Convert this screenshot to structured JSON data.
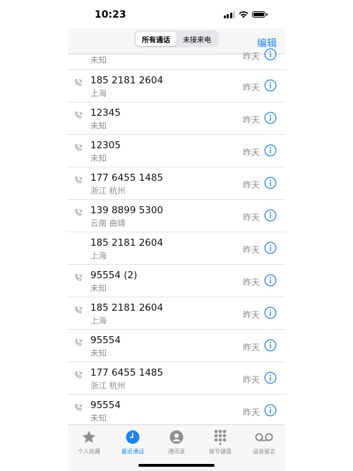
{
  "status": {
    "time": "10:23"
  },
  "header": {
    "segments": [
      "所有通话",
      "未接来电"
    ],
    "edit_label": "编辑"
  },
  "calls": [
    {
      "number": "",
      "location": "未知",
      "date": "昨天"
    },
    {
      "number": "185 2181 2604",
      "location": "上海",
      "date": "昨天",
      "icon": true
    },
    {
      "number": "12345",
      "location": "未知",
      "date": "昨天",
      "icon": true
    },
    {
      "number": "12305",
      "location": "未知",
      "date": "昨天",
      "icon": true
    },
    {
      "number": "177 6455 1485",
      "location": "浙江 杭州",
      "date": "昨天",
      "icon": true
    },
    {
      "number": "139 8899 5300",
      "location": "云南 曲靖",
      "date": "昨天",
      "icon": true
    },
    {
      "number": "185 2181 2604",
      "location": "上海",
      "date": "昨天",
      "icon": false
    },
    {
      "number": "95554 (2)",
      "location": "未知",
      "date": "昨天",
      "icon": true
    },
    {
      "number": "185 2181 2604",
      "location": "上海",
      "date": "昨天",
      "icon": true
    },
    {
      "number": "95554",
      "location": "未知",
      "date": "昨天",
      "icon": true
    },
    {
      "number": "177 6455 1485",
      "location": "浙江 杭州",
      "date": "昨天",
      "icon": true
    },
    {
      "number": "95554",
      "location": "未知",
      "date": "昨天",
      "icon": true
    }
  ],
  "tabs": [
    {
      "label": "个人收藏",
      "icon": "star-icon"
    },
    {
      "label": "最近通话",
      "icon": "clock-icon",
      "active": true
    },
    {
      "label": "通讯录",
      "icon": "contact-icon"
    },
    {
      "label": "拨号键盘",
      "icon": "keypad-icon"
    },
    {
      "label": "语音留言",
      "icon": "voicemail-icon"
    }
  ],
  "colors": {
    "accent": "#1a84f0",
    "secondary_text": "#8e8e93"
  }
}
